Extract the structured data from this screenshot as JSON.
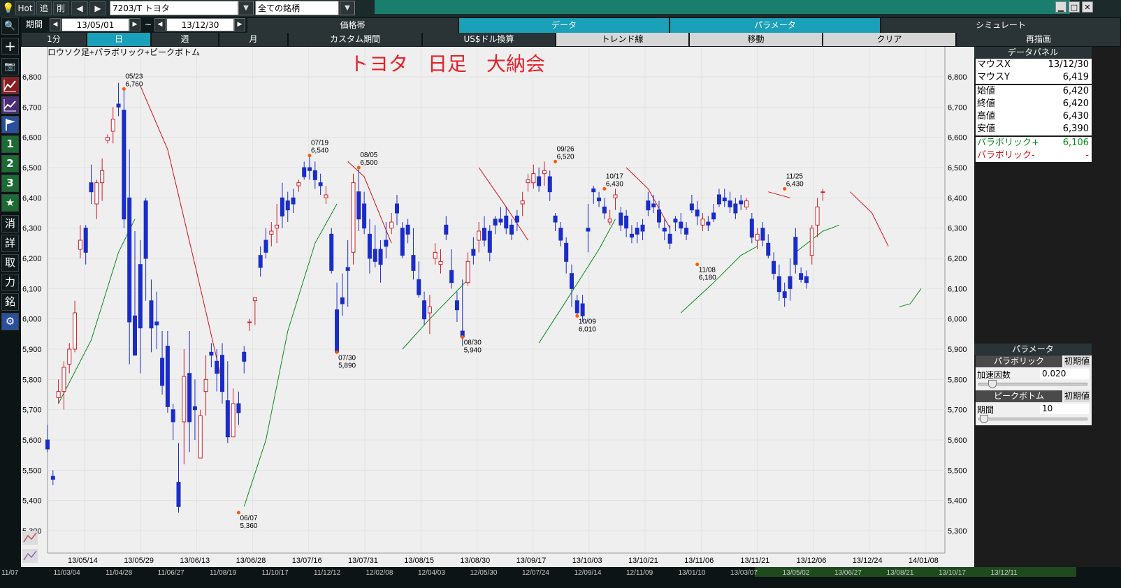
{
  "topbar": {
    "hot_label": "Hot",
    "add_label": "追",
    "del_label": "削",
    "prev_label": "◀",
    "next_label": "▶",
    "symbol_value": "7203/T トヨタ",
    "group_value": "全ての銘柄",
    "minimize": "▁",
    "maximize": "□",
    "close": "✕"
  },
  "period": {
    "label": "期間",
    "start": "13/05/01",
    "tilde": "~",
    "end": "13/12/30"
  },
  "main_tabs": [
    {
      "label": "価格帯",
      "active": false
    },
    {
      "label": "データ",
      "active": true
    },
    {
      "label": "パラメータ",
      "active": true
    },
    {
      "label": "シミュレート",
      "active": false
    }
  ],
  "interval_tabs": [
    {
      "label": "1分",
      "active": false
    },
    {
      "label": "日",
      "active": true
    },
    {
      "label": "週",
      "active": false
    },
    {
      "label": "月",
      "active": false
    }
  ],
  "function_tabs": [
    "カスタム期間",
    "US$ドル換算",
    "トレンド線",
    "移動",
    "クリア",
    "再描画"
  ],
  "left_toolbar": {
    "zoom": "🔍",
    "plus": "+",
    "camera": "📷",
    "btn1": "1",
    "btn2": "2",
    "btn3": "3",
    "star": "★",
    "k1": "消",
    "k2": "詳",
    "k3": "取",
    "k4": "力",
    "k5": "銘",
    "gear": "⚙"
  },
  "chart_data": {
    "type": "candlestick",
    "indicator_label": "ロウソク足+パラボリック+ピークボトム",
    "title": "トヨタ　日足　大納会",
    "ylim": [
      5200,
      6900
    ],
    "yticks": [
      "5,300",
      "5,400",
      "5,500",
      "5,600",
      "5,700",
      "5,800",
      "5,900",
      "6,000",
      "6,100",
      "6,200",
      "6,300",
      "6,400",
      "6,500",
      "6,600",
      "6,700",
      "6,800"
    ],
    "xticks": [
      "13/05/14",
      "13/05/29",
      "13/06/13",
      "13/06/28",
      "13/07/16",
      "13/07/31",
      "13/08/15",
      "13/08/30",
      "13/09/17",
      "13/10/03",
      "13/10/21",
      "13/11/06",
      "13/11/21",
      "13/12/06",
      "13/12/24",
      "14/01/08"
    ],
    "peaks": [
      {
        "date": "05/23",
        "value": "6,760"
      },
      {
        "date": "06/07",
        "value": "5,360"
      },
      {
        "date": "07/19",
        "value": "6,540"
      },
      {
        "date": "07/30",
        "value": "5,890"
      },
      {
        "date": "08/05",
        "value": "6,500"
      },
      {
        "date": "08/30",
        "value": "5,940"
      },
      {
        "date": "09/26",
        "value": "6,520"
      },
      {
        "date": "10/09",
        "value": "6,010"
      },
      {
        "date": "10/17",
        "value": "6,430"
      },
      {
        "date": "11/08",
        "value": "6,180"
      },
      {
        "date": "11/25",
        "value": "6,430"
      }
    ],
    "candles": [
      [
        5600,
        5650,
        5560,
        5570
      ],
      [
        5480,
        5500,
        5450,
        5470
      ],
      [
        5740,
        5800,
        5720,
        5760
      ],
      [
        5760,
        5860,
        5700,
        5840
      ],
      [
        5850,
        5920,
        5820,
        5900
      ],
      [
        5900,
        6060,
        5890,
        6020
      ],
      [
        6230,
        6310,
        6200,
        6260
      ],
      [
        6300,
        6310,
        6180,
        6220
      ],
      [
        6450,
        6510,
        6380,
        6420
      ],
      [
        6380,
        6460,
        6330,
        6450
      ],
      [
        6450,
        6530,
        6390,
        6490
      ],
      [
        6590,
        6610,
        6580,
        6600
      ],
      [
        6620,
        6700,
        6580,
        6660
      ],
      [
        6710,
        6780,
        6670,
        6700
      ],
      [
        6690,
        6760,
        6300,
        6330
      ],
      [
        6400,
        6560,
        5850,
        5990
      ],
      [
        6010,
        6290,
        5890,
        5880
      ],
      [
        6180,
        6260,
        5820,
        5970
      ],
      [
        6390,
        6400,
        6060,
        6200
      ],
      [
        6060,
        6130,
        5890,
        5970
      ],
      [
        5990,
        6090,
        5900,
        5980
      ],
      [
        5870,
        5960,
        5750,
        5780
      ],
      [
        5910,
        5960,
        5690,
        5710
      ],
      [
        5700,
        5720,
        5600,
        5660
      ],
      [
        5460,
        5590,
        5360,
        5380
      ],
      [
        5660,
        5900,
        5520,
        5810
      ],
      [
        5820,
        5960,
        5560,
        5660
      ],
      [
        5710,
        5800,
        5600,
        5700
      ],
      [
        5540,
        5700,
        5570,
        5680
      ],
      [
        5760,
        5880,
        5680,
        5800
      ],
      [
        5890,
        5920,
        5840,
        5880
      ],
      [
        5860,
        5900,
        5760,
        5820
      ],
      [
        5880,
        5920,
        5720,
        5760
      ],
      [
        5730,
        5860,
        5590,
        5610
      ],
      [
        5610,
        5770,
        5620,
        5720
      ],
      [
        5720,
        5760,
        5650,
        5690
      ],
      [
        5890,
        5910,
        5820,
        5860
      ],
      [
        5990,
        6000,
        5960,
        5990
      ],
      [
        6060,
        6070,
        5980,
        6070
      ],
      [
        6210,
        6240,
        6140,
        6170
      ],
      [
        6260,
        6300,
        6200,
        6220
      ],
      [
        6280,
        6320,
        6240,
        6290
      ],
      [
        6300,
        6380,
        6250,
        6310
      ],
      [
        6400,
        6450,
        6300,
        6340
      ],
      [
        6390,
        6420,
        6320,
        6360
      ],
      [
        6400,
        6430,
        6350,
        6380
      ],
      [
        6440,
        6460,
        6420,
        6450
      ],
      [
        6500,
        6520,
        6460,
        6470
      ],
      [
        6500,
        6540,
        6460,
        6490
      ],
      [
        6490,
        6520,
        6430,
        6460
      ],
      [
        6450,
        6480,
        6410,
        6440
      ],
      [
        6400,
        6440,
        6380,
        6410
      ],
      [
        6280,
        6300,
        6150,
        6160
      ],
      [
        6030,
        6120,
        5890,
        5890
      ],
      [
        6070,
        6150,
        6010,
        6050
      ],
      [
        6170,
        6260,
        6040,
        6160
      ],
      [
        6220,
        6480,
        6180,
        6450
      ],
      [
        6420,
        6500,
        6290,
        6330
      ],
      [
        6380,
        6420,
        6280,
        6300
      ],
      [
        6280,
        6330,
        6150,
        6200
      ],
      [
        6230,
        6310,
        6170,
        6190
      ],
      [
        6230,
        6260,
        6120,
        6180
      ],
      [
        6260,
        6320,
        6200,
        6240
      ],
      [
        6300,
        6350,
        6280,
        6320
      ],
      [
        6380,
        6410,
        6310,
        6350
      ],
      [
        6300,
        6320,
        6200,
        6210
      ],
      [
        6310,
        6330,
        6250,
        6280
      ],
      [
        6210,
        6300,
        6130,
        6160
      ],
      [
        6130,
        6190,
        6070,
        6080
      ],
      [
        6060,
        6090,
        5980,
        6000
      ],
      [
        6020,
        6080,
        5950,
        6040
      ],
      [
        6200,
        6250,
        6180,
        6220
      ],
      [
        6180,
        6230,
        6150,
        6190
      ],
      [
        6310,
        6340,
        6260,
        6280
      ],
      [
        6160,
        6230,
        6100,
        6120
      ],
      [
        6060,
        6090,
        5990,
        6030
      ],
      [
        5960,
        6130,
        5910,
        5940
      ],
      [
        6120,
        6220,
        6110,
        6190
      ],
      [
        6230,
        6270,
        6180,
        6210
      ],
      [
        6260,
        6320,
        6220,
        6290
      ],
      [
        6300,
        6340,
        6240,
        6260
      ],
      [
        6290,
        6310,
        6190,
        6220
      ],
      [
        6330,
        6340,
        6280,
        6310
      ],
      [
        6330,
        6370,
        6310,
        6320
      ],
      [
        6340,
        6370,
        6280,
        6300
      ],
      [
        6310,
        6330,
        6260,
        6280
      ],
      [
        6340,
        6360,
        6290,
        6320
      ],
      [
        6380,
        6420,
        6340,
        6390
      ],
      [
        6450,
        6480,
        6420,
        6460
      ],
      [
        6450,
        6510,
        6430,
        6480
      ],
      [
        6470,
        6500,
        6420,
        6440
      ],
      [
        6480,
        6520,
        6440,
        6490
      ],
      [
        6470,
        6490,
        6390,
        6420
      ],
      [
        6340,
        6350,
        6290,
        6320
      ],
      [
        6300,
        6320,
        6240,
        6260
      ],
      [
        6250,
        6270,
        6150,
        6190
      ],
      [
        6150,
        6180,
        6040,
        6100
      ],
      [
        6060,
        6080,
        6010,
        6020
      ],
      [
        6050,
        6080,
        5990,
        6010
      ],
      [
        6300,
        6380,
        6220,
        6290
      ],
      [
        6430,
        6440,
        6380,
        6420
      ],
      [
        6400,
        6420,
        6370,
        6390
      ],
      [
        6370,
        6400,
        6330,
        6350
      ],
      [
        6320,
        6360,
        6310,
        6330
      ],
      [
        6400,
        6430,
        6360,
        6410
      ],
      [
        6350,
        6370,
        6290,
        6310
      ],
      [
        6340,
        6360,
        6270,
        6300
      ],
      [
        6280,
        6310,
        6250,
        6270
      ],
      [
        6300,
        6320,
        6250,
        6280
      ],
      [
        6310,
        6330,
        6260,
        6290
      ],
      [
        6390,
        6420,
        6340,
        6360
      ],
      [
        6380,
        6410,
        6350,
        6370
      ],
      [
        6360,
        6390,
        6300,
        6320
      ],
      [
        6300,
        6330,
        6260,
        6290
      ],
      [
        6280,
        6310,
        6230,
        6250
      ],
      [
        6330,
        6340,
        6290,
        6320
      ],
      [
        6320,
        6350,
        6280,
        6300
      ],
      [
        6300,
        6320,
        6260,
        6280
      ],
      [
        6380,
        6410,
        6350,
        6360
      ],
      [
        6360,
        6390,
        6310,
        6340
      ],
      [
        6310,
        6350,
        6290,
        6330
      ],
      [
        6320,
        6340,
        6290,
        6310
      ],
      [
        6350,
        6380,
        6320,
        6330
      ],
      [
        6410,
        6430,
        6370,
        6380
      ],
      [
        6400,
        6430,
        6370,
        6390
      ],
      [
        6390,
        6420,
        6350,
        6370
      ],
      [
        6380,
        6400,
        6330,
        6350
      ],
      [
        6390,
        6410,
        6360,
        6380
      ],
      [
        6370,
        6400,
        6360,
        6390
      ],
      [
        6330,
        6350,
        6250,
        6270
      ],
      [
        6260,
        6300,
        6230,
        6280
      ],
      [
        6300,
        6320,
        6240,
        6260
      ],
      [
        6250,
        6280,
        6200,
        6210
      ],
      [
        6190,
        6220,
        6130,
        6150
      ],
      [
        6140,
        6180,
        6060,
        6090
      ],
      [
        6090,
        6120,
        6040,
        6070
      ],
      [
        6140,
        6200,
        6060,
        6100
      ],
      [
        6270,
        6300,
        6150,
        6180
      ],
      [
        6150,
        6170,
        6120,
        6130
      ],
      [
        6140,
        6160,
        6100,
        6120
      ],
      [
        6210,
        6310,
        6180,
        6300
      ],
      [
        6310,
        6400,
        6270,
        6370
      ],
      [
        6420,
        6430,
        6390,
        6420
      ]
    ],
    "parabolic_sar": [
      {
        "pts": [
          [
            2,
            5720
          ],
          [
            8,
            5930
          ],
          [
            13,
            6220
          ],
          [
            16,
            6330
          ]
        ],
        "color": "#0a8a1e"
      },
      {
        "pts": [
          [
            17,
            6770
          ],
          [
            22,
            6560
          ],
          [
            27,
            6180
          ],
          [
            32,
            5790
          ]
        ],
        "color": "#d0111b"
      },
      {
        "pts": [
          [
            36,
            5380
          ],
          [
            40,
            5600
          ],
          [
            44,
            5960
          ],
          [
            49,
            6250
          ],
          [
            53,
            6380
          ]
        ],
        "color": "#0a8a1e"
      },
      {
        "pts": [
          [
            55,
            6520
          ],
          [
            58,
            6470
          ],
          [
            63,
            6250
          ]
        ],
        "color": "#d0111b"
      },
      {
        "pts": [
          [
            65,
            5900
          ],
          [
            70,
            6000
          ],
          [
            77,
            6130
          ]
        ],
        "color": "#0a8a1e"
      },
      {
        "pts": [
          [
            79,
            6500
          ],
          [
            84,
            6370
          ],
          [
            88,
            6260
          ]
        ],
        "color": "#d0111b"
      },
      {
        "pts": [
          [
            90,
            5920
          ],
          [
            95,
            6060
          ],
          [
            101,
            6230
          ],
          [
            104,
            6330
          ]
        ],
        "color": "#0a8a1e"
      },
      {
        "pts": [
          [
            106,
            6500
          ],
          [
            110,
            6430
          ],
          [
            114,
            6300
          ]
        ],
        "color": "#d0111b"
      },
      {
        "pts": [
          [
            116,
            6020
          ],
          [
            122,
            6120
          ],
          [
            127,
            6210
          ],
          [
            130,
            6240
          ]
        ],
        "color": "#0a8a1e"
      },
      {
        "pts": [
          [
            132,
            6420
          ],
          [
            136,
            6400
          ]
        ],
        "color": "#d0111b"
      },
      {
        "pts": [
          [
            137,
            6220
          ],
          [
            142,
            6290
          ],
          [
            145,
            6310
          ]
        ],
        "color": "#0a8a1e"
      },
      {
        "pts": [
          [
            147,
            6420
          ],
          [
            151,
            6350
          ],
          [
            154,
            6240
          ]
        ],
        "color": "#d0111b"
      },
      {
        "pts": [
          [
            156,
            6040
          ],
          [
            158,
            6050
          ],
          [
            160,
            6100
          ]
        ],
        "color": "#0a8a1e"
      }
    ]
  },
  "data_panel": {
    "title": "データパネル",
    "rows": [
      {
        "key": "マウスX",
        "value": "13/12/30"
      },
      {
        "key": "マウスY",
        "value": "6,419"
      },
      {
        "key": "始値",
        "value": "6,420"
      },
      {
        "key": "終値",
        "value": "6,420"
      },
      {
        "key": "高値",
        "value": "6,430"
      },
      {
        "key": "安値",
        "value": "6,390"
      },
      {
        "key": "パラボリック+",
        "value": "6,106"
      },
      {
        "key": "パラボリック-",
        "value": "-"
      }
    ]
  },
  "params_panel": {
    "title": "パラメータ",
    "parabolic_label": "パラボリック",
    "init_label": "初期値",
    "accel_label": "加速因数",
    "accel_value": "0.020",
    "accel_level": 0.08,
    "peak_label": "ピークボトム",
    "init_label2": "初期値",
    "period_label": "期間",
    "period_value": "10",
    "period_level": 0.0
  },
  "bottom_ticks": [
    "11/07",
    "11/03/04",
    "11/04/28",
    "11/06/27",
    "11/08/19",
    "11/10/17",
    "11/12/12",
    "12/02/08",
    "12/04/03",
    "12/05/30",
    "12/07/24",
    "12/09/14",
    "12/11/09",
    "13/01/10",
    "13/03/07",
    "13/05/02",
    "13/06/27",
    "13/08/21",
    "13/10/17",
    "13/12/11"
  ],
  "colors": {
    "bull": "#cc1f26",
    "bear": "#1a2cc8",
    "title": "#e52128",
    "teal": "#1a7e6f",
    "active_tab": "#1aa0b8"
  }
}
